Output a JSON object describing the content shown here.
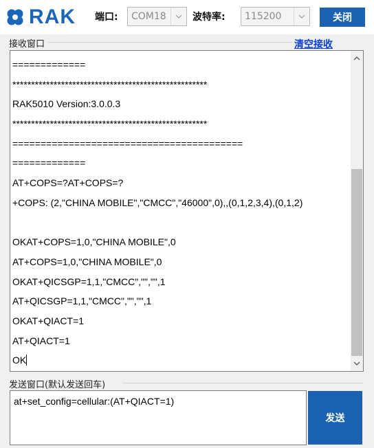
{
  "header": {
    "logo_text": "RAK",
    "port_label": "端口:",
    "port_value": "COM18",
    "baud_label": "波特率:",
    "baud_value": "115200",
    "close_label": "关闭"
  },
  "receive": {
    "group_title": "接收窗口",
    "clear_label": "清空接收",
    "lines": [
      "=============",
      "****************************************************",
      "RAK5010 Version:3.0.0.3",
      "****************************************************",
      "=========================================",
      "=============",
      "AT+COPS=?AT+COPS=?",
      "+COPS: (2,\"CHINA MOBILE\",\"CMCC\",\"46000\",0),,(0,1,2,3,4),(0,1,2)",
      "",
      "OKAT+COPS=1,0,\"CHINA MOBILE\",0",
      "AT+COPS=1,0,\"CHINA MOBILE\",0",
      "OKAT+QICSGP=1,1,\"CMCC\",\"\",\"\",1",
      "AT+QICSGP=1,1,\"CMCC\",\"\",\"\",1",
      "OKAT+QIACT=1",
      "AT+QIACT=1",
      "OK"
    ]
  },
  "send": {
    "group_title": "发送窗口(默认发送回车)",
    "input_value": "at+set_config=cellular:(AT+QIACT=1)",
    "send_label": "发送"
  },
  "colors": {
    "brand_blue": "#1b63b1",
    "link_blue": "#0b3fd6"
  },
  "icons": {
    "logo": "rak-logo-icon",
    "combo_arrow": "chevron-down-icon",
    "scroll_up": "scroll-up-icon",
    "scroll_down": "scroll-down-icon"
  }
}
